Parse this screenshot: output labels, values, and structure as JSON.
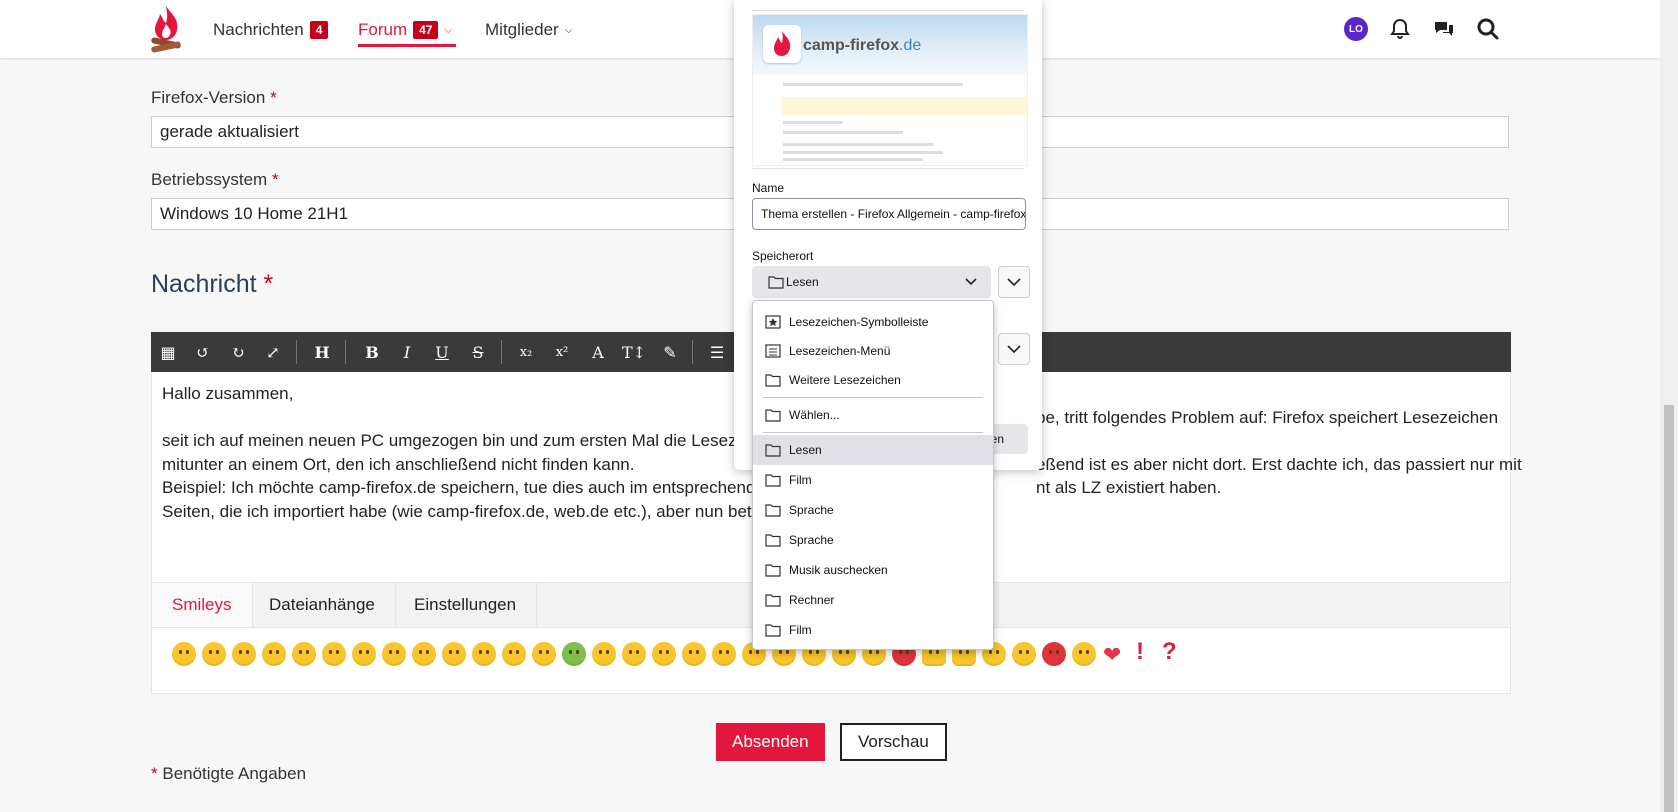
{
  "header": {
    "nav": [
      {
        "label": "Nachrichten",
        "badge": "4"
      },
      {
        "label": "Forum",
        "badge": "47"
      },
      {
        "label": "Mitglieder"
      }
    ],
    "avatar_initials": "LO",
    "accent": "#e3173e"
  },
  "form": {
    "firefox_version_label": "Firefox-Version",
    "firefox_version_value": "gerade aktualisiert",
    "os_label": "Betriebssystem",
    "os_value": "Windows 10 Home 21H1",
    "required_mark": "*",
    "message_title": "Nachricht",
    "editor_lines": [
      "Hallo zusammen,",
      "",
      "seit ich auf meinen neuen PC umgezogen bin und zum ersten Mal die Lesezei",
      "mitunter an einem Ort, den ich anschließend nicht finden kann.",
      "Beispiel: Ich möchte camp-firefox.de speichern, tue dies auch im entsprechende",
      "Seiten, die ich importiert habe (wie camp-firefox.de, web.de etc.), aber nun betr"
    ],
    "editor_tail_lines": [
      "",
      "",
      "be, tritt folgendes Problem auf: Firefox speichert Lesezeichen",
      "",
      "eßend ist es aber nicht dort. Erst dachte ich, das passiert nur mit",
      "nt als LZ existiert haben."
    ],
    "tabs": [
      "Smileys",
      "Dateianhänge",
      "Einstellungen"
    ],
    "submit_label": "Absenden",
    "preview_label": "Vorschau",
    "required_note": "Benötigte Angaben"
  },
  "popup": {
    "thumb_site_name": "camp-firefox",
    "thumb_site_tld": ".de",
    "name_label": "Name",
    "name_value": "Thema erstellen - Firefox Allgemein - camp-firefox.de",
    "location_label": "Speicherort",
    "location_value": "Lesen",
    "partial_button": "nen",
    "menu": [
      {
        "label": "Lesezeichen-Symbolleiste",
        "icon": "star-folder-icon"
      },
      {
        "label": "Lesezeichen-Menü",
        "icon": "menu-list-icon"
      },
      {
        "label": "Weitere Lesezeichen",
        "icon": "folder-icon"
      },
      {
        "label": "Wählen...",
        "icon": "folder-icon"
      },
      {
        "label": "Lesen",
        "icon": "folder-icon",
        "selected": true
      },
      {
        "label": "Film",
        "icon": "folder-icon"
      },
      {
        "label": "Sprache",
        "icon": "folder-icon"
      },
      {
        "label": "Sprache",
        "icon": "folder-icon"
      },
      {
        "label": "Musik auschecken",
        "icon": "folder-icon"
      },
      {
        "label": "Rechner",
        "icon": "folder-icon"
      },
      {
        "label": "Film",
        "icon": "folder-icon"
      }
    ]
  }
}
